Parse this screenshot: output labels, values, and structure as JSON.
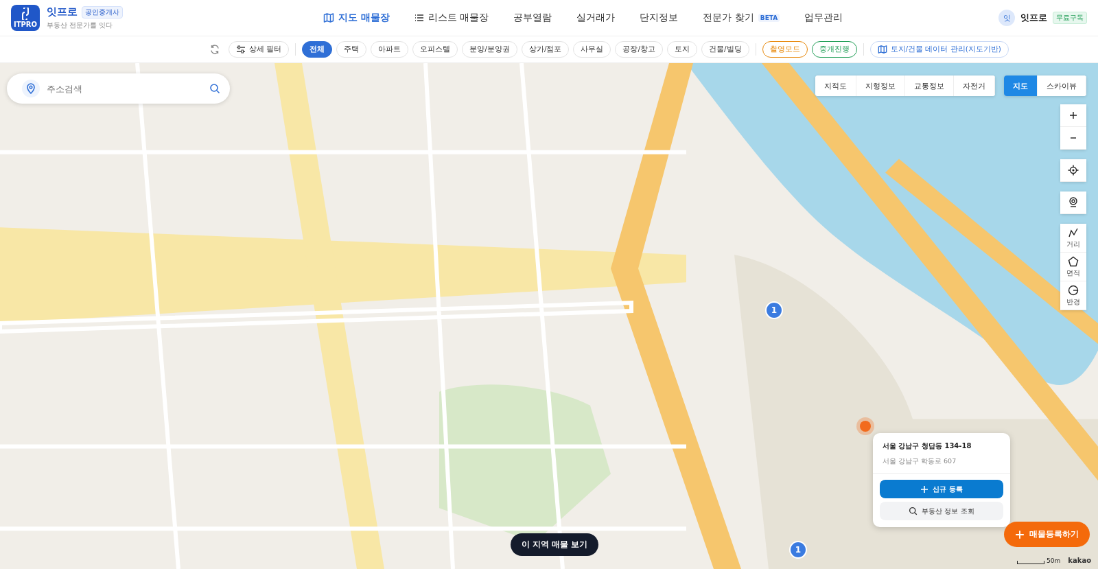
{
  "brand": {
    "logo_text": "ITPRO",
    "name": "잇프로",
    "badge": "공인중개사",
    "tagline": "부동산 전문가를 잇다"
  },
  "nav": [
    {
      "label": "지도 매물장",
      "kind": "map",
      "selected": true
    },
    {
      "label": "리스트 매물장",
      "kind": "list",
      "selected": false
    },
    {
      "label": "공부열람",
      "kind": "plain",
      "selected": false
    },
    {
      "label": "실거래가",
      "kind": "plain",
      "selected": false
    },
    {
      "label": "단지정보",
      "kind": "plain",
      "selected": false
    },
    {
      "label": "전문가 찾기",
      "kind": "plain",
      "badge": "BETA",
      "selected": false
    },
    {
      "label": "업무관리",
      "kind": "plain",
      "selected": false
    }
  ],
  "user": {
    "avatar": "잇",
    "name": "잇프로",
    "plan": "무료구독"
  },
  "filters": {
    "detail": "상세 필터",
    "types": [
      {
        "label": "전체",
        "selected": true
      },
      {
        "label": "주택",
        "selected": false
      },
      {
        "label": "아파트",
        "selected": false
      },
      {
        "label": "오피스텔",
        "selected": false
      },
      {
        "label": "분양/분양권",
        "selected": false
      },
      {
        "label": "상가/점포",
        "selected": false
      },
      {
        "label": "사무실",
        "selected": false
      },
      {
        "label": "공장/창고",
        "selected": false
      },
      {
        "label": "토지",
        "selected": false
      },
      {
        "label": "건물/빌딩",
        "selected": false
      }
    ],
    "modes": [
      {
        "label": "촬영모드",
        "color": "#e8890c"
      },
      {
        "label": "중개진행",
        "color": "#1f9d55"
      }
    ],
    "data_link": "토지/건물 데이터 관리(지도기반)"
  },
  "search": {
    "placeholder": "주소검색"
  },
  "layers": [
    {
      "label": "지적도",
      "selected": false
    },
    {
      "label": "지형정보",
      "selected": false
    },
    {
      "label": "교통정보",
      "selected": false
    },
    {
      "label": "자전거",
      "selected": false
    }
  ],
  "map_types": [
    {
      "label": "지도",
      "selected": true
    },
    {
      "label": "스카이뷰",
      "selected": false
    }
  ],
  "tools": [
    {
      "label": "거리",
      "kind": "distance"
    },
    {
      "label": "면적",
      "kind": "area"
    },
    {
      "label": "반경",
      "kind": "radius"
    }
  ],
  "clusters": [
    {
      "count": "1"
    },
    {
      "count": "1"
    }
  ],
  "popup": {
    "address": "서울 강남구 청담동 134-18",
    "road_address": "서울 강남구 학동로 607",
    "primary": "신규 등록",
    "secondary": "부동산 정보 조회"
  },
  "area_button": "이 지역 매물 보기",
  "register_button": "매물등록하기",
  "scale": "50m",
  "attribution": "kakao"
}
